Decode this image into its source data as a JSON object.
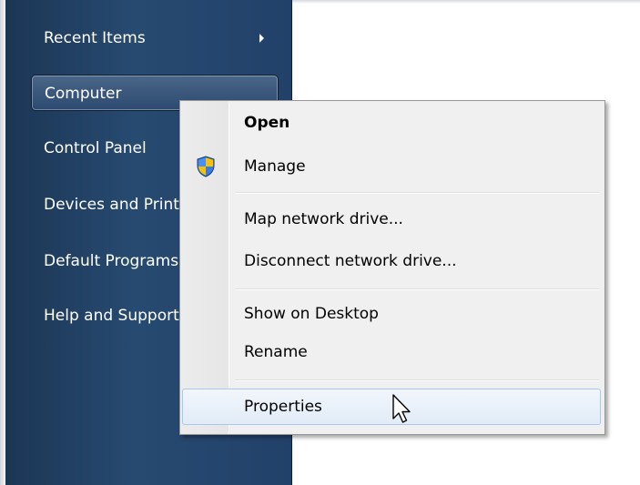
{
  "sidebar": {
    "items": [
      {
        "label": "Recent Items"
      },
      {
        "label": "Computer"
      },
      {
        "label": "Control Panel"
      },
      {
        "label": "Devices and Printers"
      },
      {
        "label": "Default Programs"
      },
      {
        "label": "Help and Support"
      }
    ]
  },
  "context_menu": {
    "items": [
      {
        "label": "Open"
      },
      {
        "label": "Manage"
      },
      {
        "label": "Map network drive..."
      },
      {
        "label": "Disconnect network drive..."
      },
      {
        "label": "Show on Desktop"
      },
      {
        "label": "Rename"
      },
      {
        "label": "Properties"
      }
    ],
    "shield_icon": "uac-shield-icon",
    "hover_item": "Properties"
  },
  "colors": {
    "sidebar": "#274a70",
    "menu_bg": "#f0f0f0",
    "hover_border": "#a8c8ee",
    "shield_blue": "#2a6fd6",
    "shield_yellow": "#f4c20d"
  }
}
